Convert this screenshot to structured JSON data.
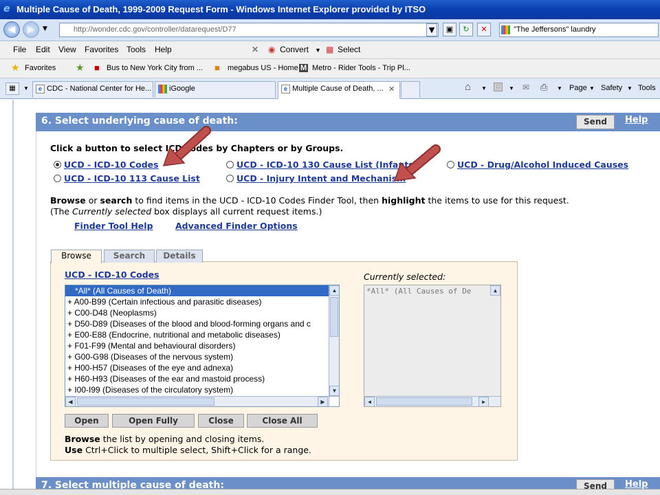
{
  "window": {
    "title": "Multiple Cause of Death, 1999-2009 Request Form - Windows Internet Explorer provided by ITSO"
  },
  "addressbar": {
    "url": "http://wonder.cdc.gov/controller/datarequest/D77",
    "search_value": "\"The Jeffersons\" laundry"
  },
  "menubar": {
    "items": [
      "File",
      "Edit",
      "View",
      "Favorites",
      "Tools",
      "Help"
    ],
    "convert": "Convert",
    "select": "Select"
  },
  "favorites": {
    "label": "Favorites",
    "items": [
      "Bus to New York City from ...",
      "megabus US - Home",
      "Metro - Rider Tools - Trip Pl..."
    ]
  },
  "tabs": [
    {
      "label": "CDC - National Center for He..."
    },
    {
      "label": "iGoogle"
    },
    {
      "label": "Multiple Cause of Death, ..."
    }
  ],
  "commandbar": {
    "page": "Page",
    "safety": "Safety",
    "tools": "Tools"
  },
  "section6": {
    "title": "6. Select underlying cause of death:",
    "send": "Send",
    "help": "Help",
    "instruction": "Click a button to select ICD codes by Chapters or by Groups.",
    "options": [
      "UCD - ICD-10 Codes",
      "UCD - ICD-10 130 Cause List (Infants)",
      "UCD - Drug/Alcohol Induced Causes",
      "UCD - ICD-10 113 Cause List",
      "UCD - Injury Intent and Mechanism"
    ],
    "browse_word": "Browse",
    "or_word": "or",
    "search_word": "search",
    "browse_text_mid": "to find items in the UCD - ICD-10 Codes Finder Tool, then",
    "highlight_word": "highlight",
    "browse_text_end": "the items to use for this request.",
    "currently_pre": "(The",
    "currently_word": "Currently selected",
    "currently_post": "box displays all current request items.)",
    "finder_help": "Finder Tool Help",
    "advanced": "Advanced Finder Options"
  },
  "finder": {
    "tabs": [
      "Browse",
      "Search",
      "Details"
    ],
    "list_title": "UCD - ICD-10 Codes",
    "selected_title": "Currently selected:",
    "items": [
      "*All*  (All Causes of Death)",
      "+ A00-B99  (Certain infectious and parasitic diseases)",
      "+ C00-D48  (Neoplasms)",
      "+ D50-D89  (Diseases of the blood and blood-forming organs and c",
      "+ E00-E88  (Endocrine, nutritional and metabolic diseases)",
      "+ F01-F99  (Mental and behavioural disorders)",
      "+ G00-G98  (Diseases of the nervous system)",
      "+ H00-H57  (Diseases of the eye and adnexa)",
      "+ H60-H93  (Diseases of the ear and mastoid process)",
      "+ I00-I99  (Diseases of the circulatory system)"
    ],
    "selected_items": [
      "*All* (All Causes of De"
    ],
    "buttons": [
      "Open",
      "Open Fully",
      "Close",
      "Close All"
    ],
    "browse_word": "Browse",
    "browse_help": "the list by opening and closing items.",
    "use_word": "Use",
    "use_help": "Ctrl+Click to multiple select, Shift+Click for a range."
  },
  "section7": {
    "title": "7. Select multiple cause of death:",
    "send": "Send",
    "help": "Help"
  },
  "colors": {
    "header": "#6b8fc9",
    "arrow": "#c0504d",
    "selected_row": "#316ac5"
  }
}
